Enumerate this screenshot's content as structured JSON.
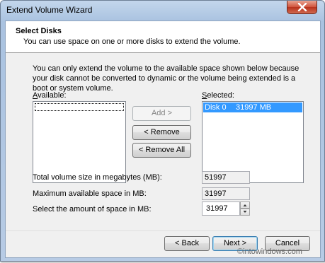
{
  "window": {
    "title": "Extend Volume Wizard"
  },
  "header": {
    "title": "Select Disks",
    "subtitle": "You can use space on one or more disks to extend the volume."
  },
  "description": "You can only extend the volume to the available space shown below because your disk cannot be converted to dynamic or the volume being extended is a boot or system volume.",
  "available": {
    "label": "Available:",
    "items": []
  },
  "selected": {
    "label": "Selected:",
    "items": [
      {
        "disk": "Disk 0",
        "size": "31997 MB"
      }
    ]
  },
  "buttons": {
    "add": "Add >",
    "remove": "< Remove",
    "remove_all": "< Remove All",
    "back": "< Back",
    "next": "Next >",
    "cancel": "Cancel"
  },
  "fields": {
    "total_label": "Total volume size in megabytes (MB):",
    "total_value": "51997",
    "max_label": "Maximum available space in MB:",
    "max_value": "31997",
    "amount_label": "Select the amount of space in MB:",
    "amount_value": "31997"
  },
  "watermark": "©intowindows.com"
}
